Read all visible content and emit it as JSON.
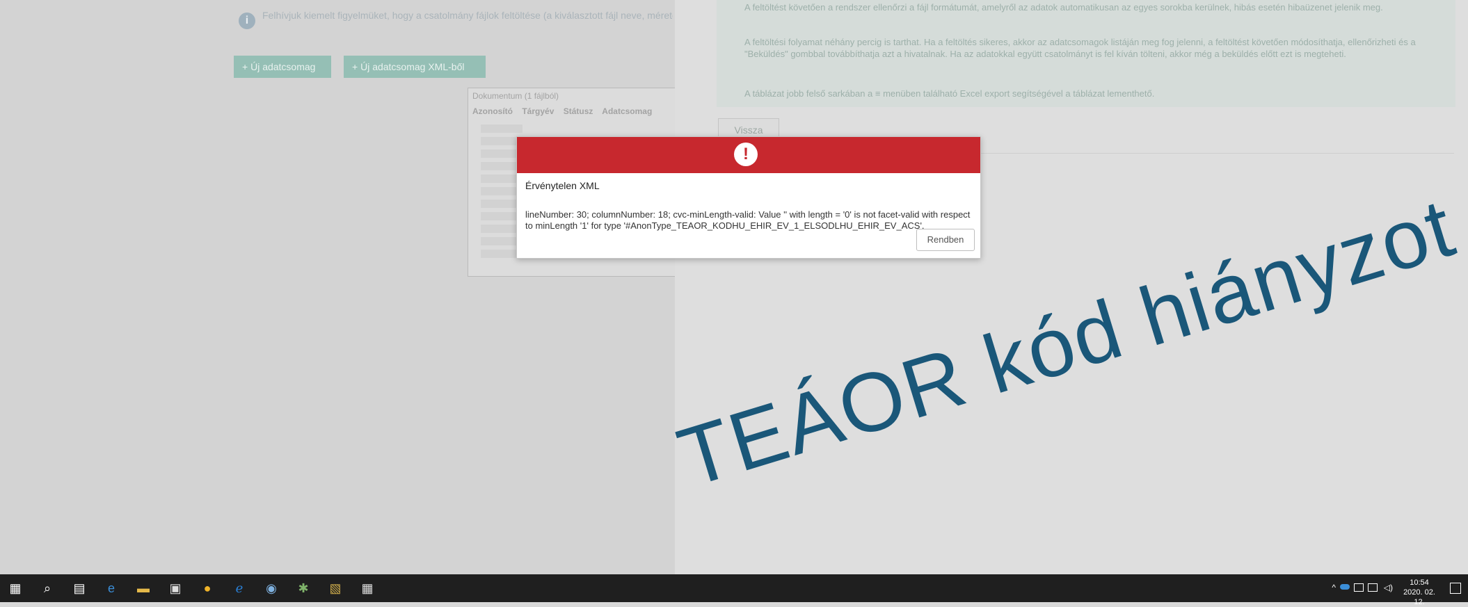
{
  "left": {
    "banner_text": "Felhívjuk kiemelt figyelmüket, hogy a csatolmány fájlok feltöltése (a kiválasztott fájl neve, mérete) megjelenik a listában. A feltöltést követően a rendszer automatikusan ellenőrzi.",
    "btn_new": "Új adatcsomag",
    "btn_new2": "Új adatcsomag XML-ből",
    "table_header": "Dokumentum (1 fájlból)",
    "table_cols": [
      "Azonosító",
      "Tárgyév",
      "Státusz",
      "Adatcsomag"
    ]
  },
  "right": {
    "help_p1": "A feltöltést követően a rendszer ellenőrzi a fájl formátumát, amelyről az adatok automatikusan az egyes sorokba kerülnek, hibás esetén hibaüzenet jelenik meg.",
    "help_p2": "A feltöltési folyamat néhány percig is tarthat. Ha a feltöltés sikeres, akkor az adatcsomagok listáján meg fog jelenni, a feltöltést követően módosíthatja, ellenőrizheti és a \"Beküldés\" gombbal továbbíthatja azt a hivatalnak. Ha az adatokkal együtt csatolmányt is fel kíván tölteni, akkor még a beküldés előtt ezt is megteheti.",
    "help_p3": "A táblázat jobb felső sarkában a ≡ menüben található Excel export segítségével a táblázat lementhető.",
    "back_label": "Vissza"
  },
  "modal": {
    "title": "Érvénytelen XML",
    "message": "lineNumber: 30; columnNumber: 18; cvc-minLength-valid: Value '' with length = '0' is not facet-valid with respect to minLength '1' for type '#AnonType_TEAOR_KODHU_EHIR_EV_1_ELSODLHU_EHIR_EV_ACS'.",
    "ok_label": "Rendben",
    "header_color": "#c7282e"
  },
  "overlay_caption": "TEÁOR kód hiányzot",
  "taskbar": {
    "icons": [
      "windows-start-icon",
      "search-icon",
      "task-view-icon",
      "edge-icon",
      "file-explorer-icon",
      "store-icon",
      "chrome-icon",
      "ie-icon",
      "app-icon",
      "teams-icon",
      "app2-icon",
      "calculator-icon"
    ],
    "time": "10:54",
    "date": "2020. 02. 12."
  }
}
